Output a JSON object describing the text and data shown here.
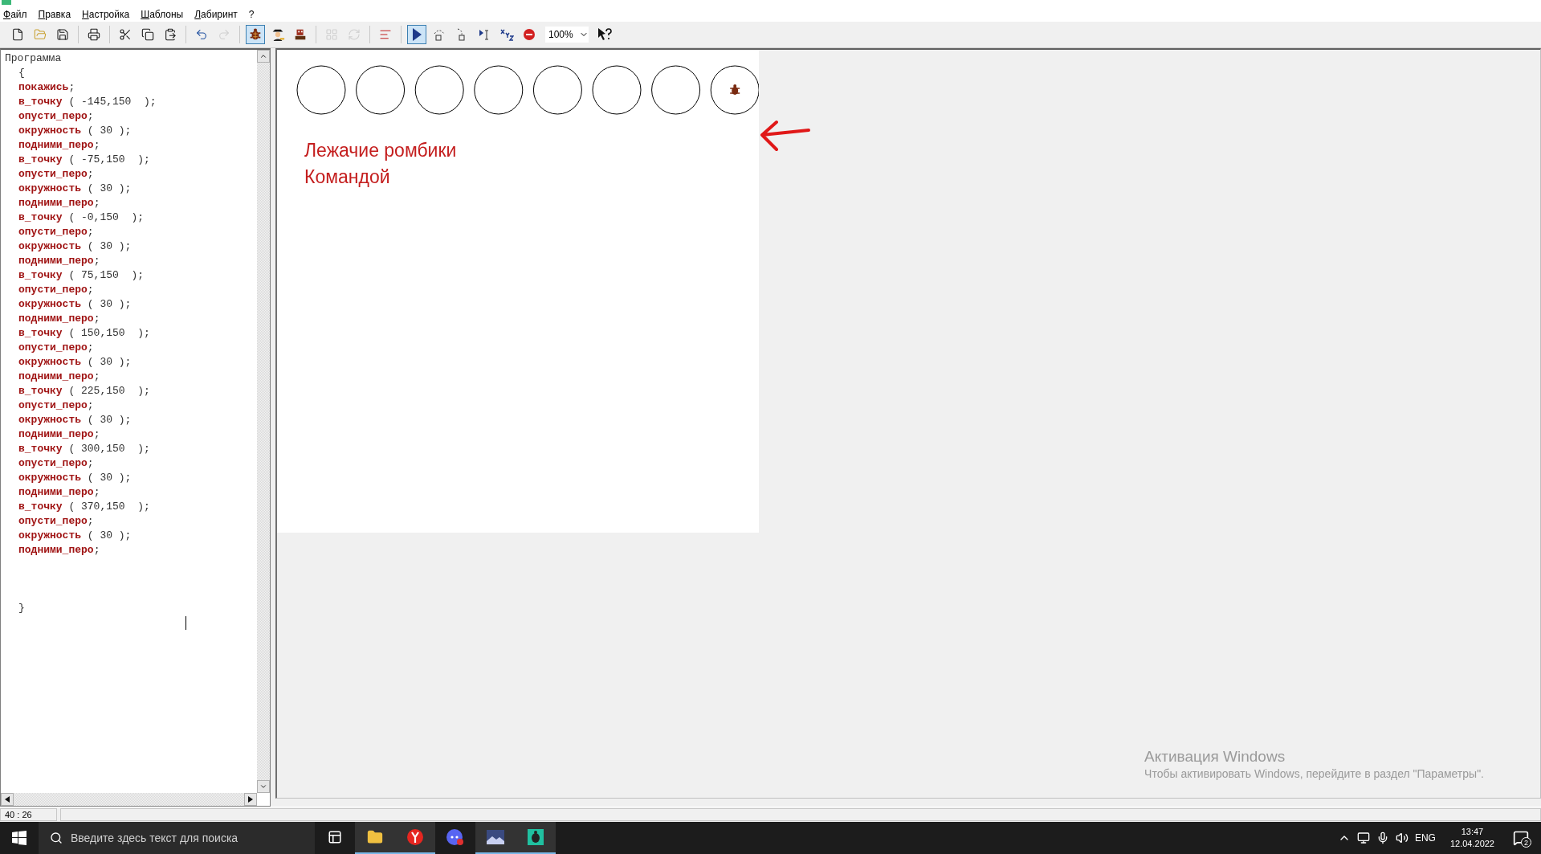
{
  "menu": [
    {
      "label": "Файл"
    },
    {
      "label": "Правка"
    },
    {
      "label": "Настройка"
    },
    {
      "label": "Шаблоны"
    },
    {
      "label": "Лабиринт"
    },
    {
      "label": "?"
    }
  ],
  "toolbar": [
    {
      "kind": "new",
      "selected": false,
      "disabled": false
    },
    {
      "kind": "open",
      "selected": false,
      "disabled": false
    },
    {
      "kind": "save",
      "selected": false,
      "disabled": false
    },
    {
      "kind": "separator"
    },
    {
      "kind": "print",
      "selected": false,
      "disabled": false
    },
    {
      "kind": "separator"
    },
    {
      "kind": "cut",
      "selected": false,
      "disabled": false
    },
    {
      "kind": "copy",
      "selected": false,
      "disabled": false
    },
    {
      "kind": "paste",
      "selected": false,
      "disabled": false
    },
    {
      "kind": "separator"
    },
    {
      "kind": "undo",
      "selected": false,
      "disabled": false
    },
    {
      "kind": "redo",
      "selected": false,
      "disabled": true
    },
    {
      "kind": "separator"
    },
    {
      "kind": "turtle",
      "selected": true,
      "disabled": false
    },
    {
      "kind": "painter",
      "selected": false,
      "disabled": false
    },
    {
      "kind": "robot",
      "selected": false,
      "disabled": false
    },
    {
      "kind": "separator"
    },
    {
      "kind": "grid",
      "selected": false,
      "disabled": true
    },
    {
      "kind": "refresh",
      "selected": false,
      "disabled": true
    },
    {
      "kind": "separator"
    },
    {
      "kind": "lines",
      "selected": false,
      "disabled": false
    },
    {
      "kind": "separator"
    },
    {
      "kind": "run",
      "selected": true,
      "disabled": false
    },
    {
      "kind": "step-over",
      "selected": false,
      "disabled": false
    },
    {
      "kind": "step-into",
      "selected": false,
      "disabled": false
    },
    {
      "kind": "run-to-cursor",
      "selected": false,
      "disabled": false
    },
    {
      "kind": "xyz",
      "selected": false,
      "disabled": false
    },
    {
      "kind": "stop",
      "selected": false,
      "disabled": false
    }
  ],
  "zoom": {
    "value": "100%"
  },
  "editor": {
    "lines": [
      {
        "kind": "header",
        "text": "Программа"
      },
      {
        "kind": "plain",
        "text": "{"
      },
      {
        "kind": "cmd",
        "keyword": "покажись",
        "args": ";"
      },
      {
        "kind": "cmd",
        "keyword": "в_точку",
        "args": " ( -145,150  );"
      },
      {
        "kind": "cmd",
        "keyword": "опусти_перо",
        "args": ";"
      },
      {
        "kind": "cmd",
        "keyword": "окружность",
        "args": " ( 30 );"
      },
      {
        "kind": "cmd",
        "keyword": "подними_перо",
        "args": ";"
      },
      {
        "kind": "cmd",
        "keyword": "в_точку",
        "args": " ( -75,150  );"
      },
      {
        "kind": "cmd",
        "keyword": "опусти_перо",
        "args": ";"
      },
      {
        "kind": "cmd",
        "keyword": "окружность",
        "args": " ( 30 );"
      },
      {
        "kind": "cmd",
        "keyword": "подними_перо",
        "args": ";"
      },
      {
        "kind": "cmd",
        "keyword": "в_точку",
        "args": " ( -0,150  );"
      },
      {
        "kind": "cmd",
        "keyword": "опусти_перо",
        "args": ";"
      },
      {
        "kind": "cmd",
        "keyword": "окружность",
        "args": " ( 30 );"
      },
      {
        "kind": "cmd",
        "keyword": "подними_перо",
        "args": ";"
      },
      {
        "kind": "cmd",
        "keyword": "в_точку",
        "args": " ( 75,150  );"
      },
      {
        "kind": "cmd",
        "keyword": "опусти_перо",
        "args": ";"
      },
      {
        "kind": "cmd",
        "keyword": "окружность",
        "args": " ( 30 );"
      },
      {
        "kind": "cmd",
        "keyword": "подними_перо",
        "args": ";"
      },
      {
        "kind": "cmd",
        "keyword": "в_точку",
        "args": " ( 150,150  );"
      },
      {
        "kind": "cmd",
        "keyword": "опусти_перо",
        "args": ";"
      },
      {
        "kind": "cmd",
        "keyword": "окружность",
        "args": " ( 30 );"
      },
      {
        "kind": "cmd",
        "keyword": "подними_перо",
        "args": ";"
      },
      {
        "kind": "cmd",
        "keyword": "в_точку",
        "args": " ( 225,150  );"
      },
      {
        "kind": "cmd",
        "keyword": "опусти_перо",
        "args": ";"
      },
      {
        "kind": "cmd",
        "keyword": "окружность",
        "args": " ( 30 );"
      },
      {
        "kind": "cmd",
        "keyword": "подними_перо",
        "args": ";"
      },
      {
        "kind": "cmd",
        "keyword": "в_точку",
        "args": " ( 300,150  );"
      },
      {
        "kind": "cmd",
        "keyword": "опусти_перо",
        "args": ";"
      },
      {
        "kind": "cmd",
        "keyword": "окружность",
        "args": " ( 30 );"
      },
      {
        "kind": "cmd",
        "keyword": "подними_перо",
        "args": ";"
      },
      {
        "kind": "cmd",
        "keyword": "в_точку",
        "args": " ( 370,150  );"
      },
      {
        "kind": "cmd",
        "keyword": "опусти_перо",
        "args": ";"
      },
      {
        "kind": "cmd",
        "keyword": "окружность",
        "args": " ( 30 );"
      },
      {
        "kind": "cmd",
        "keyword": "подними_перо",
        "args": ";"
      },
      {
        "kind": "close",
        "text": "}"
      }
    ]
  },
  "canvas": {
    "circles": [
      {
        "turtle": false
      },
      {
        "turtle": false
      },
      {
        "turtle": false
      },
      {
        "turtle": false
      },
      {
        "turtle": false
      },
      {
        "turtle": false
      },
      {
        "turtle": false
      },
      {
        "turtle": true
      }
    ],
    "note": [
      "Лежачие ромбики",
      "Командой"
    ]
  },
  "activation": {
    "title": "Активация Windows",
    "text": "Чтобы активировать Windows, перейдите в раздел \"Параметры\"."
  },
  "status_bar": {
    "position": "40 : 26"
  },
  "taskbar": {
    "search": {
      "placeholder": "Введите здесь текст для поиска"
    },
    "apps": [
      {
        "kind": "taskview",
        "selected": false
      },
      {
        "kind": "explorer",
        "selected": true
      },
      {
        "kind": "yandex",
        "selected": true
      },
      {
        "kind": "discord",
        "selected": false
      },
      {
        "kind": "picture",
        "selected": true
      },
      {
        "kind": "turtle",
        "selected": true
      }
    ],
    "language": "ENG",
    "time": "13:47",
    "date": "12.04.2022",
    "notifications": "2"
  }
}
